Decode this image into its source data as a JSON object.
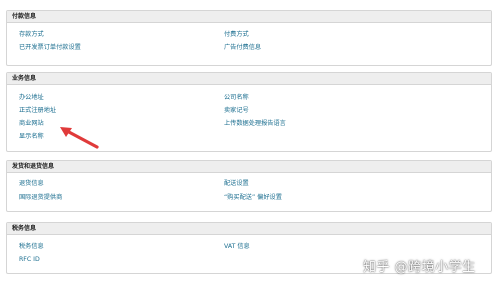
{
  "sections": {
    "payment": {
      "title": "付款信息",
      "left": [
        "存款方式",
        "已开发票订单付款设置"
      ],
      "right": [
        "付费方式",
        "广告付费信息"
      ]
    },
    "business": {
      "title": "业务信息",
      "left": [
        "办公地址",
        "正式注册地址",
        "商业网站",
        "显示名称"
      ],
      "right": [
        "公司名称",
        "卖家记号",
        "上传数据处理报告语言"
      ]
    },
    "shipping": {
      "title": "发货和退货信息",
      "left": [
        "退货信息",
        "国际退货提供商"
      ],
      "right": [
        "配送设置",
        "“购买配送” 偏好设置"
      ]
    },
    "tax": {
      "title": "税务信息",
      "left": [
        "税务信息",
        "RFC ID"
      ],
      "right": [
        "VAT 信息"
      ]
    }
  },
  "annotation": {
    "arrow_color": "#e03a3a"
  },
  "watermark": "知乎 @跨境小学生"
}
